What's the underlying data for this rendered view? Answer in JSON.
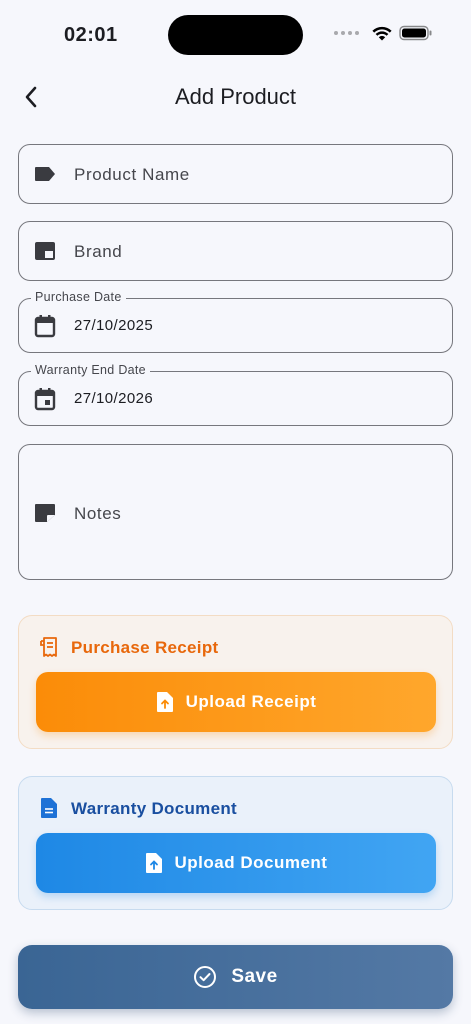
{
  "status_bar": {
    "time": "02:01"
  },
  "header": {
    "title": "Add Product",
    "back_icon": "chevron-left-icon"
  },
  "form": {
    "product_name": {
      "placeholder": "Product Name",
      "icon": "label-icon"
    },
    "brand": {
      "placeholder": "Brand",
      "icon": "branding-icon"
    },
    "purchase_date": {
      "label": "Purchase Date",
      "value": "27/10/2025",
      "icon": "calendar-icon"
    },
    "warranty_end_date": {
      "label": "Warranty End Date",
      "value": "27/10/2026",
      "icon": "event-icon"
    },
    "notes": {
      "placeholder": "Notes",
      "icon": "note-icon"
    }
  },
  "receipt_card": {
    "title": "Purchase Receipt",
    "button_label": "Upload Receipt",
    "accent": "#e8680c",
    "icon": "receipt-icon"
  },
  "warranty_card": {
    "title": "Warranty Document",
    "button_label": "Upload Document",
    "accent": "#1a4fa0",
    "icon": "document-icon"
  },
  "save_button": {
    "label": "Save",
    "icon": "check-circle-icon"
  },
  "colors": {
    "background": "#f6f7fc",
    "orange": "#fb8c08",
    "blue": "#1e88e5",
    "save": "#3a6594"
  }
}
